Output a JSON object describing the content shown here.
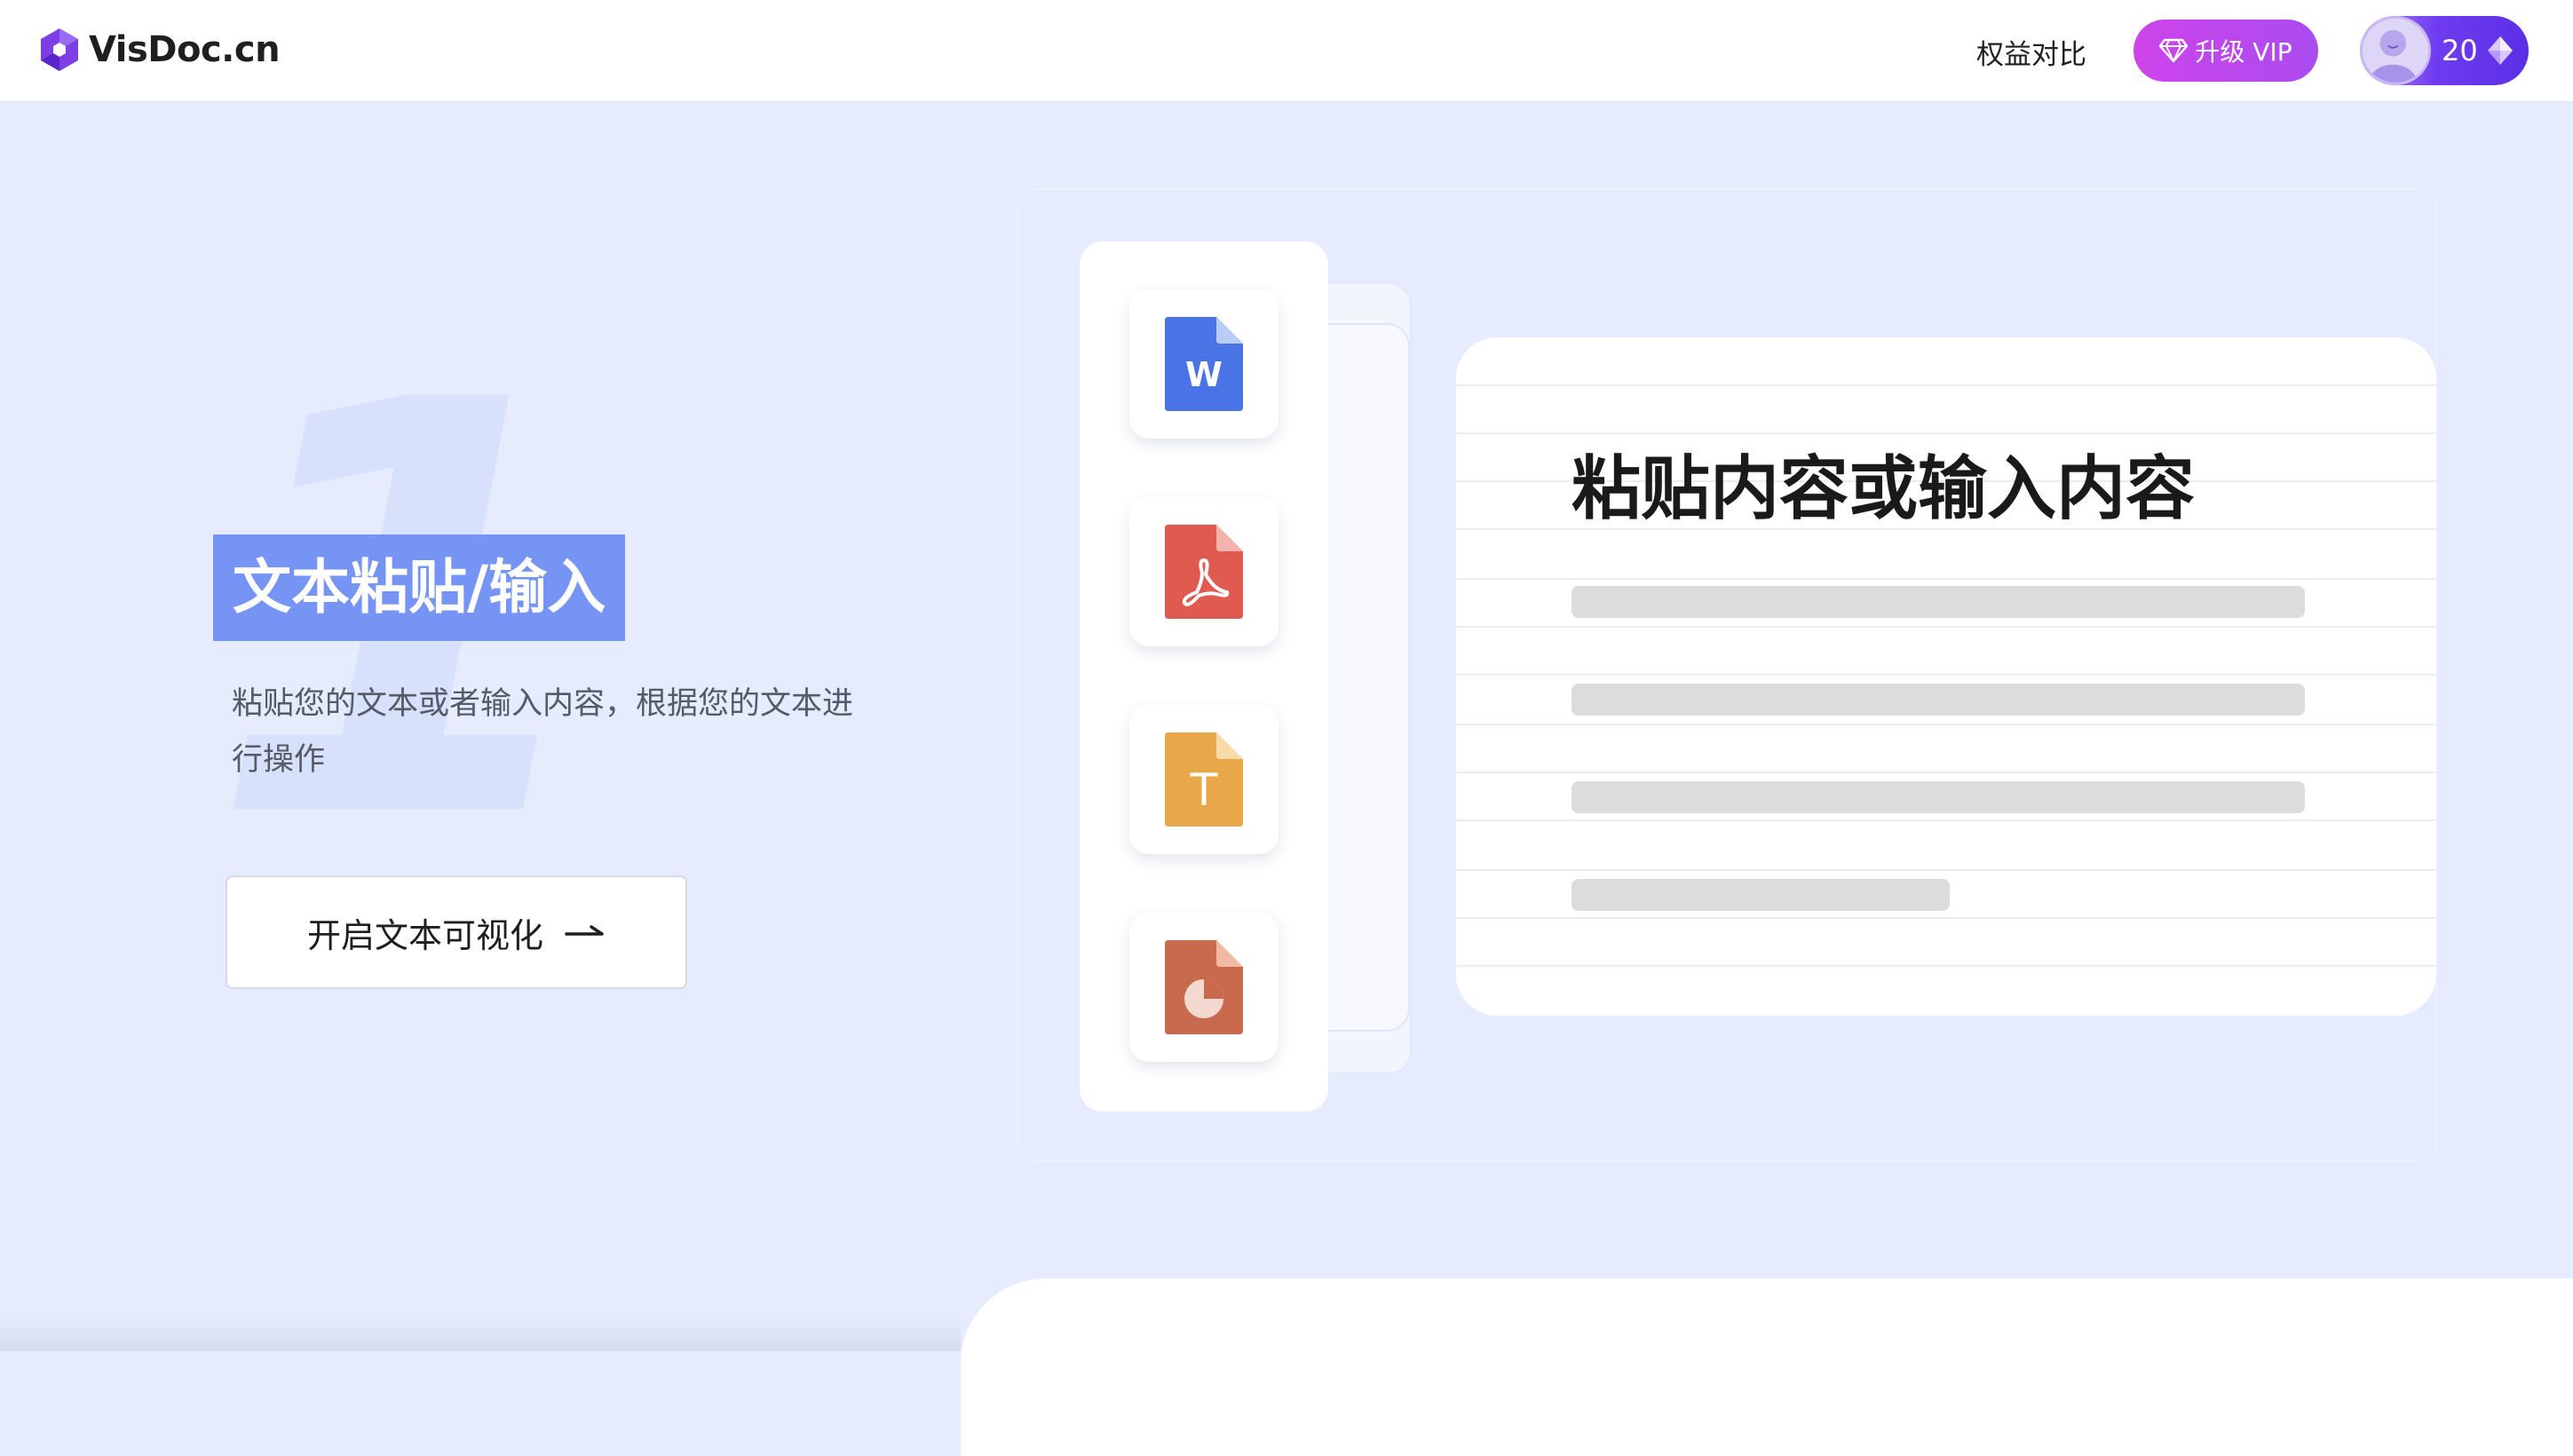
{
  "header": {
    "brand": "VisDoc.cn",
    "nav_compare": "权益对比",
    "vip_label": "升级 VIP",
    "credits": "20",
    "icons": {
      "logo": "visdoc-logo-icon",
      "vip": "diamond-icon",
      "credits": "gem-icon",
      "avatar": "user-avatar-icon"
    },
    "colors": {
      "vip_gradient_start": "#cf44ea",
      "vip_gradient_end": "#a94cf0",
      "credits_bg": "#6f3cf0",
      "brand_purple": "#7b3fe4"
    }
  },
  "hero": {
    "step_number": "1",
    "title": "文本粘贴/输入",
    "description": "粘贴您的文本或者输入内容，根据您的文本进行操作",
    "cta_label": "开启文本可视化",
    "icons": {
      "cta": "arrow-right-icon"
    },
    "colors": {
      "title_bg": "#7694f3",
      "page_bg": "#e6ebfd"
    }
  },
  "illustration": {
    "file_types": [
      {
        "name": "word",
        "letter": "W",
        "color": "#4a73e6"
      },
      {
        "name": "pdf",
        "letter": "",
        "color": "#e05a4f"
      },
      {
        "name": "text",
        "letter": "T",
        "color": "#e8a84a"
      },
      {
        "name": "ppt",
        "letter": "",
        "color": "#c96a4e"
      }
    ],
    "editor_title": "粘贴内容或输入内容",
    "placeholder_lines": 4
  }
}
